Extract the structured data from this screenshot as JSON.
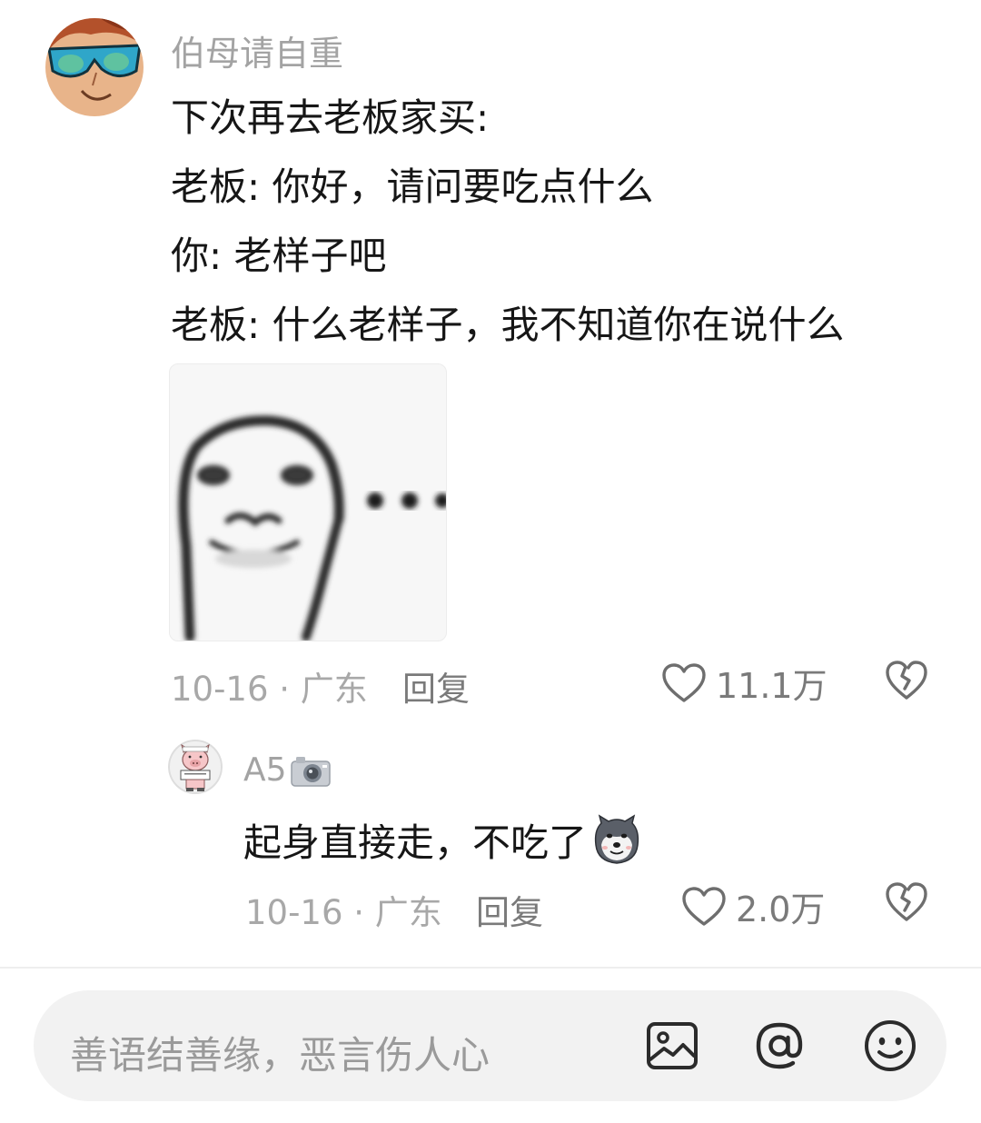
{
  "comments": [
    {
      "username": "伯母请自重",
      "lines": [
        "下次再去老板家买:",
        "老板: 你好，请问要吃点什么",
        "你: 老样子吧",
        "老板: 什么老样子，我不知道你在说什么"
      ],
      "sticker_text": "···",
      "meta": "10-16 · 广东",
      "reply_label": "回复",
      "likes": "11.1万",
      "icons": {
        "avatar": "anime-avatar-sunglasses",
        "sticker": "doodle-face-sticker",
        "like": "heart-icon",
        "dislike": "broken-heart-icon"
      }
    },
    {
      "username": "A5",
      "username_icon": "camera-emoji",
      "text": "起身直接走，不吃了",
      "text_emoji": "doge-emoji",
      "meta": "10-16 · 广东",
      "reply_label": "回复",
      "likes": "2.0万",
      "icons": {
        "avatar": "piggy-avatar",
        "like": "heart-icon",
        "dislike": "broken-heart-icon"
      }
    }
  ],
  "input_bar": {
    "placeholder": "善语结善缘，恶言伤人心",
    "icons": [
      "image-icon",
      "at-icon",
      "emoji-icon"
    ]
  },
  "colors": {
    "meta_text": "#a8a8a8",
    "body_text": "#161616",
    "input_bg": "#f2f2f2"
  }
}
